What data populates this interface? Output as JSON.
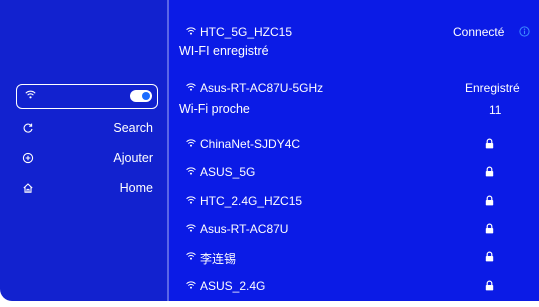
{
  "sidebar": {
    "items": [
      {
        "label": "Search",
        "icon": "refresh-icon"
      },
      {
        "label": "Ajouter",
        "icon": "add-circle-icon"
      },
      {
        "label": "Home",
        "icon": "home-icon"
      }
    ]
  },
  "connected": {
    "ssid": "HTC_5G_HZC15",
    "status": "Connecté"
  },
  "saved": {
    "title": "WI-FI enregistré",
    "networks": [
      {
        "ssid": "Asus-RT-AC87U-5GHz",
        "status": "Enregistré"
      }
    ]
  },
  "nearby": {
    "title": "Wi-Fi proche",
    "count": "11",
    "networks": [
      {
        "ssid": "ChinaNet-SJDY4C"
      },
      {
        "ssid": "ASUS_5G"
      },
      {
        "ssid": "HTC_2.4G_HZC15"
      },
      {
        "ssid": "Asus-RT-AC87U"
      },
      {
        "ssid": "李连锡"
      },
      {
        "ssid": "ASUS_2.4G"
      }
    ]
  },
  "colors": {
    "sidebar_bg": "#1222cf",
    "main_bg": "#0b1be6",
    "toggle_knob": "#1a6cff",
    "info_icon": "#3d8bff"
  }
}
